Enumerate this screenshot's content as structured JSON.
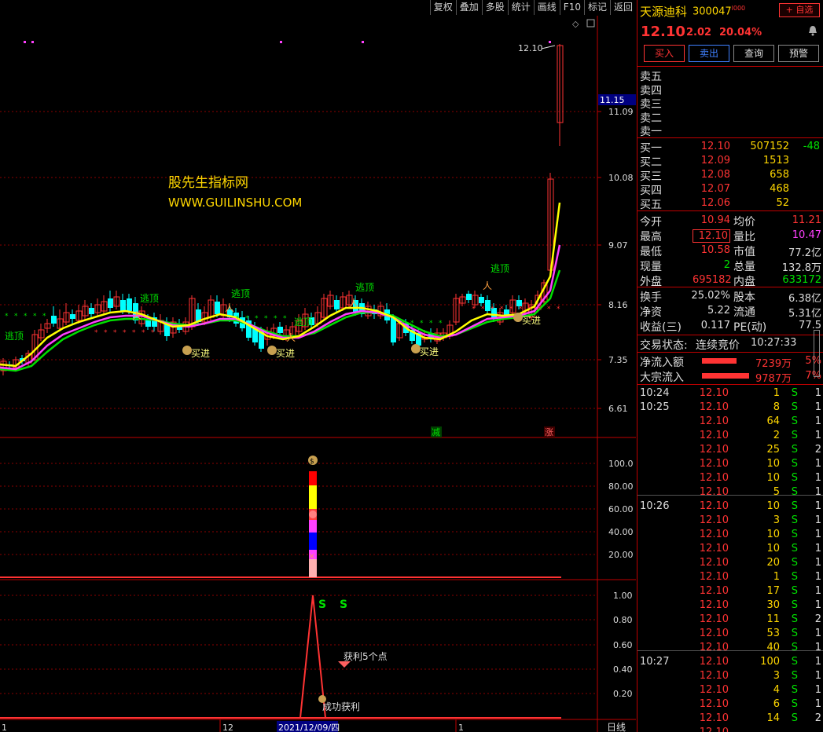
{
  "toolbar": {
    "items": [
      "复权",
      "叠加",
      "多股",
      "统计",
      "画线",
      "F10",
      "标记",
      "返回"
    ]
  },
  "watermark": {
    "line1": "股先生指标网",
    "line2": "WWW.GUILINSHU.COM"
  },
  "price_axis": {
    "current_price_tag": "11.15",
    "ticks": [
      "11.09",
      "10.08",
      "9.07",
      "8.16",
      "7.35",
      "6.61"
    ],
    "last_label": "12.10"
  },
  "signals": {
    "escape": "逃顶",
    "buy": "买进",
    "jian": "减",
    "zhang": "涨"
  },
  "ind1_axis": [
    "100.0",
    "80.00",
    "60.00",
    "40.00",
    "20.00"
  ],
  "ind2_axis": [
    "1.00",
    "0.80",
    "0.60",
    "0.40",
    "0.20"
  ],
  "ind2": {
    "s": "S",
    "profit5": "获利5个点",
    "success": "成功获利"
  },
  "bottom": {
    "m1": "1",
    "m2": "12",
    "date": "2021/12/09/四",
    "m3": "1",
    "period": "日线"
  },
  "stock": {
    "name": "天源迪科",
    "code": "300047",
    "sup": "l000",
    "add_watch": "+ 自选",
    "price": "12.10",
    "change": "2.02",
    "change_pct": "20.04%"
  },
  "buttons": {
    "buy": "买入",
    "sell": "卖出",
    "query": "查询",
    "alert": "预警"
  },
  "asks": [
    {
      "label": "卖五"
    },
    {
      "label": "卖四"
    },
    {
      "label": "卖三"
    },
    {
      "label": "卖二"
    },
    {
      "label": "卖一"
    }
  ],
  "bids": [
    {
      "label": "买一",
      "price": "12.10",
      "vol": "507152",
      "diff": "-48"
    },
    {
      "label": "买二",
      "price": "12.09",
      "vol": "1513",
      "diff": ""
    },
    {
      "label": "买三",
      "price": "12.08",
      "vol": "658",
      "diff": ""
    },
    {
      "label": "买四",
      "price": "12.07",
      "vol": "468",
      "diff": ""
    },
    {
      "label": "买五",
      "price": "12.06",
      "vol": "52",
      "diff": ""
    }
  ],
  "stats": [
    {
      "l1": "今开",
      "v1": "10.94",
      "l2": "均价",
      "v2": "11.21"
    },
    {
      "l1": "最高",
      "v1": "12.10",
      "l2": "量比",
      "v2": "10.47"
    },
    {
      "l1": "最低",
      "v1": "10.58",
      "l2": "市值",
      "v2": "77.2亿"
    },
    {
      "l1": "现量",
      "v1": "2",
      "l2": "总量",
      "v2": "132.8万"
    },
    {
      "l1": "外盘",
      "v1": "695182",
      "l2": "内盘",
      "v2": "633172"
    }
  ],
  "stats2": [
    {
      "l1": "换手",
      "v1": "25.02%",
      "l2": "股本",
      "v2": "6.38亿"
    },
    {
      "l1": "净资",
      "v1": "5.22",
      "l2": "流通",
      "v2": "5.31亿"
    },
    {
      "l1": "收益(三)",
      "v1": "0.117",
      "l2": "PE(动)",
      "v2": "77.5"
    }
  ],
  "trade_status": {
    "label": "交易状态:",
    "value": "连续竞价",
    "time": "10:27:33"
  },
  "flows": [
    {
      "label": "净流入额",
      "value": "7239万",
      "pct": "5%",
      "fill": 0.55
    },
    {
      "label": "大宗流入",
      "value": "9787万",
      "pct": "7%",
      "fill": 0.75
    }
  ],
  "ticks": [
    {
      "time": "10:24",
      "price": "12.10",
      "vol": "1",
      "bs": "S",
      "n": "1"
    },
    {
      "time": "10:25",
      "price": "12.10",
      "vol": "8",
      "bs": "S",
      "n": "1"
    },
    {
      "time": "",
      "price": "12.10",
      "vol": "64",
      "bs": "S",
      "n": "1"
    },
    {
      "time": "",
      "price": "12.10",
      "vol": "2",
      "bs": "S",
      "n": "1"
    },
    {
      "time": "",
      "price": "12.10",
      "vol": "25",
      "bs": "S",
      "n": "2"
    },
    {
      "time": "",
      "price": "12.10",
      "vol": "10",
      "bs": "S",
      "n": "1"
    },
    {
      "time": "",
      "price": "12.10",
      "vol": "10",
      "bs": "S",
      "n": "1"
    },
    {
      "time": "",
      "price": "12.10",
      "vol": "5",
      "bs": "S",
      "n": "1"
    },
    {
      "time": "10:26",
      "price": "12.10",
      "vol": "10",
      "bs": "S",
      "n": "1"
    },
    {
      "time": "",
      "price": "12.10",
      "vol": "3",
      "bs": "S",
      "n": "1"
    },
    {
      "time": "",
      "price": "12.10",
      "vol": "10",
      "bs": "S",
      "n": "1"
    },
    {
      "time": "",
      "price": "12.10",
      "vol": "10",
      "bs": "S",
      "n": "1"
    },
    {
      "time": "",
      "price": "12.10",
      "vol": "20",
      "bs": "S",
      "n": "1"
    },
    {
      "time": "",
      "price": "12.10",
      "vol": "1",
      "bs": "S",
      "n": "1"
    },
    {
      "time": "",
      "price": "12.10",
      "vol": "17",
      "bs": "S",
      "n": "1"
    },
    {
      "time": "",
      "price": "12.10",
      "vol": "30",
      "bs": "S",
      "n": "1"
    },
    {
      "time": "",
      "price": "12.10",
      "vol": "11",
      "bs": "S",
      "n": "2"
    },
    {
      "time": "",
      "price": "12.10",
      "vol": "53",
      "bs": "S",
      "n": "1"
    },
    {
      "time": "",
      "price": "12.10",
      "vol": "40",
      "bs": "S",
      "n": "1"
    },
    {
      "time": "10:27",
      "price": "12.10",
      "vol": "100",
      "bs": "S",
      "n": "1"
    },
    {
      "time": "",
      "price": "12.10",
      "vol": "3",
      "bs": "S",
      "n": "1"
    },
    {
      "time": "",
      "price": "12.10",
      "vol": "4",
      "bs": "S",
      "n": "1"
    },
    {
      "time": "",
      "price": "12.10",
      "vol": "6",
      "bs": "S",
      "n": "1"
    },
    {
      "time": "",
      "price": "12.10",
      "vol": "14",
      "bs": "S",
      "n": "2"
    },
    {
      "time": "",
      "price": "12.10",
      "vol": "",
      "bs": "",
      "n": ""
    }
  ],
  "colors": {
    "up": "#ff3333",
    "down": "#00ffff",
    "ma1": "#ffff00",
    "ma2": "#ff40ff",
    "ma3": "#00e000",
    "grid": "#8b0000"
  }
}
